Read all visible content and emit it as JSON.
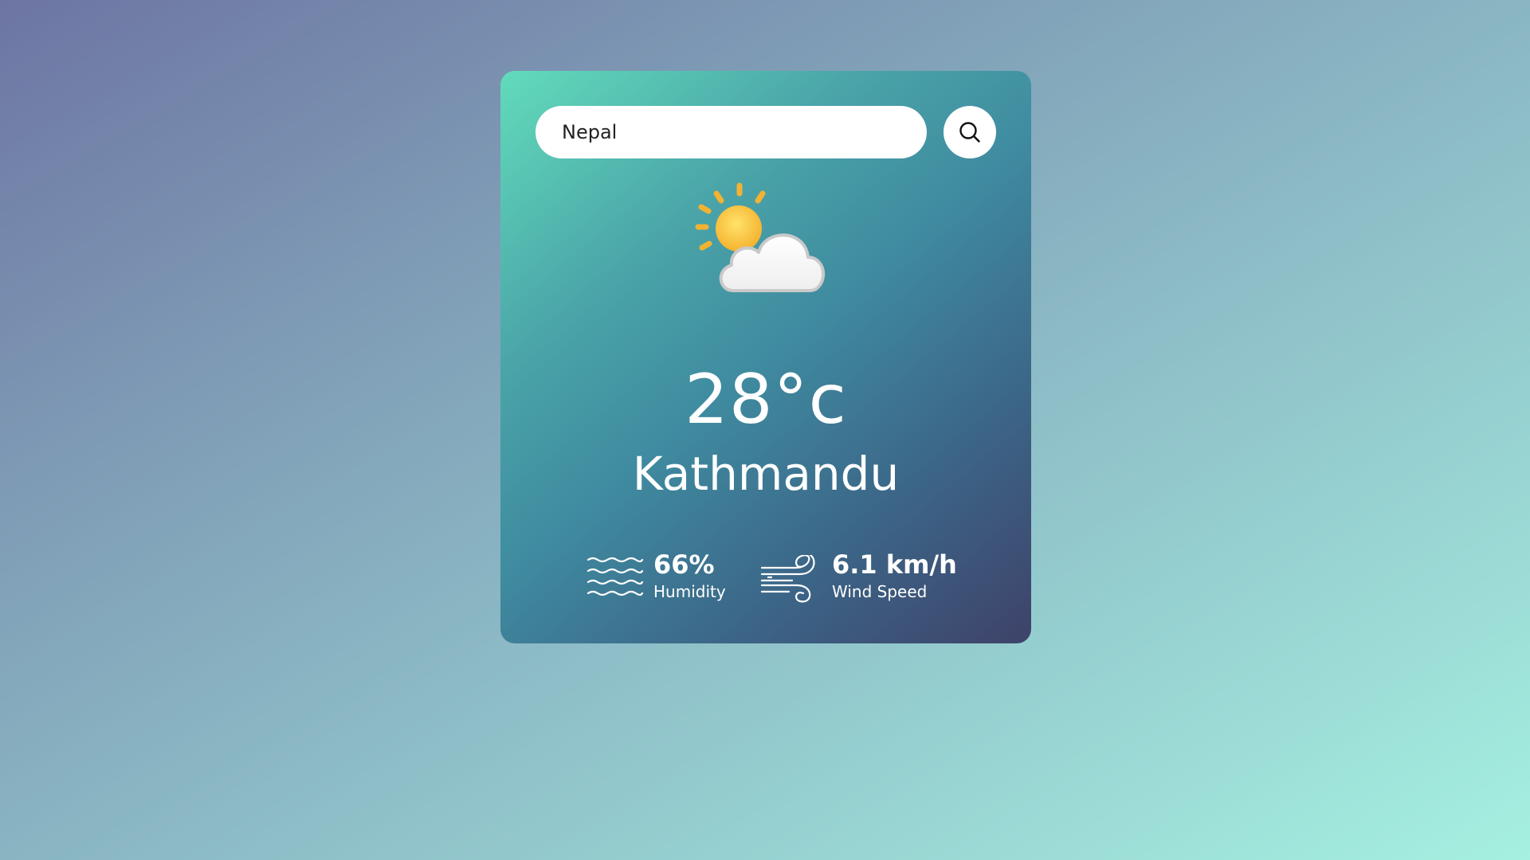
{
  "search": {
    "value": "Nepal",
    "icon": "search-icon"
  },
  "weather": {
    "icon": "partly-cloudy-icon",
    "temperature": "28°c",
    "city": "Kathmandu"
  },
  "details": {
    "humidity": {
      "icon": "humidity-waves-icon",
      "value": "66%",
      "label": "Humidity"
    },
    "wind": {
      "icon": "wind-icon",
      "value": "6.1 km/h",
      "label": "Wind Speed"
    }
  },
  "colors": {
    "card_top": "#62dbbb",
    "card_bottom": "#3e4269",
    "page_top": "#6d75a3",
    "page_bottom": "#a5f0e0",
    "sun": "#f5b93a"
  }
}
